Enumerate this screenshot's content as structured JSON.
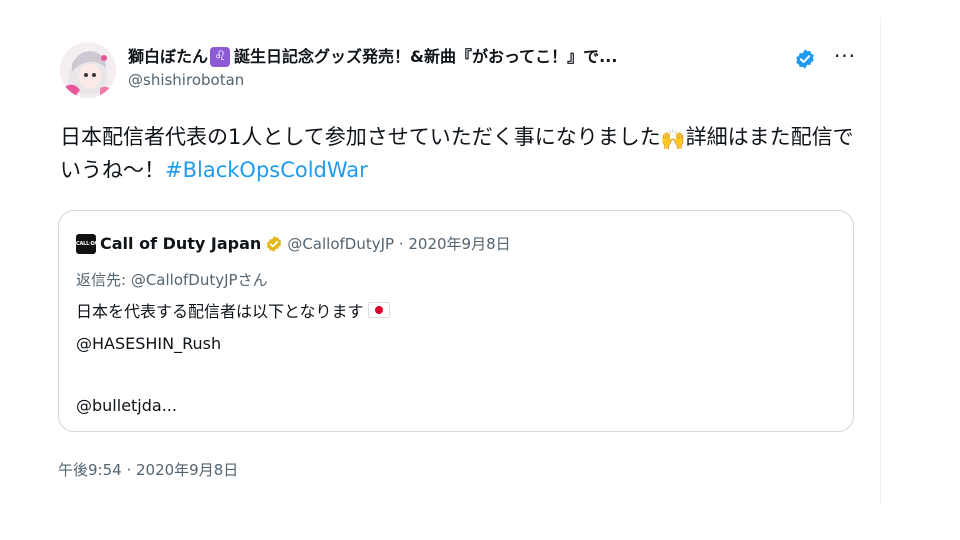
{
  "tweet": {
    "author": {
      "name_prefix": "獅白ぼたん",
      "zodiac_glyph": "♌",
      "name_suffix": "誕生日記念グッズ発売！&新曲『がおってこ！』で...",
      "handle": "@shishirobotan",
      "verified": true
    },
    "more_glyph": "···",
    "text_part1": "日本配信者代表の1人として参加させていただく事になりました",
    "raised_hands_glyph": "🙌",
    "text_part2": "詳細はまた配信でいうね〜！",
    "hashtag": "#BlackOpsColdWar",
    "timestamp": "午後9:54 · 2020年9月8日"
  },
  "quote": {
    "avatar_text": "CALL·DUTY",
    "name": "Call of Duty Japan",
    "meta": "@CallofDutyJP · 2020年9月8日",
    "reply_to": "返信先: @CallofDutyJPさん",
    "line1": "日本を代表する配信者は以下となります",
    "line2": "@HASESHIN_Rush",
    "line3": "@bulletjda..."
  },
  "colors": {
    "link": "#1d9bf0",
    "secondary_text": "#536471",
    "border": "#cfd9de",
    "verified_blue": "#1d9bf0",
    "verified_gold": "#e2b719"
  }
}
